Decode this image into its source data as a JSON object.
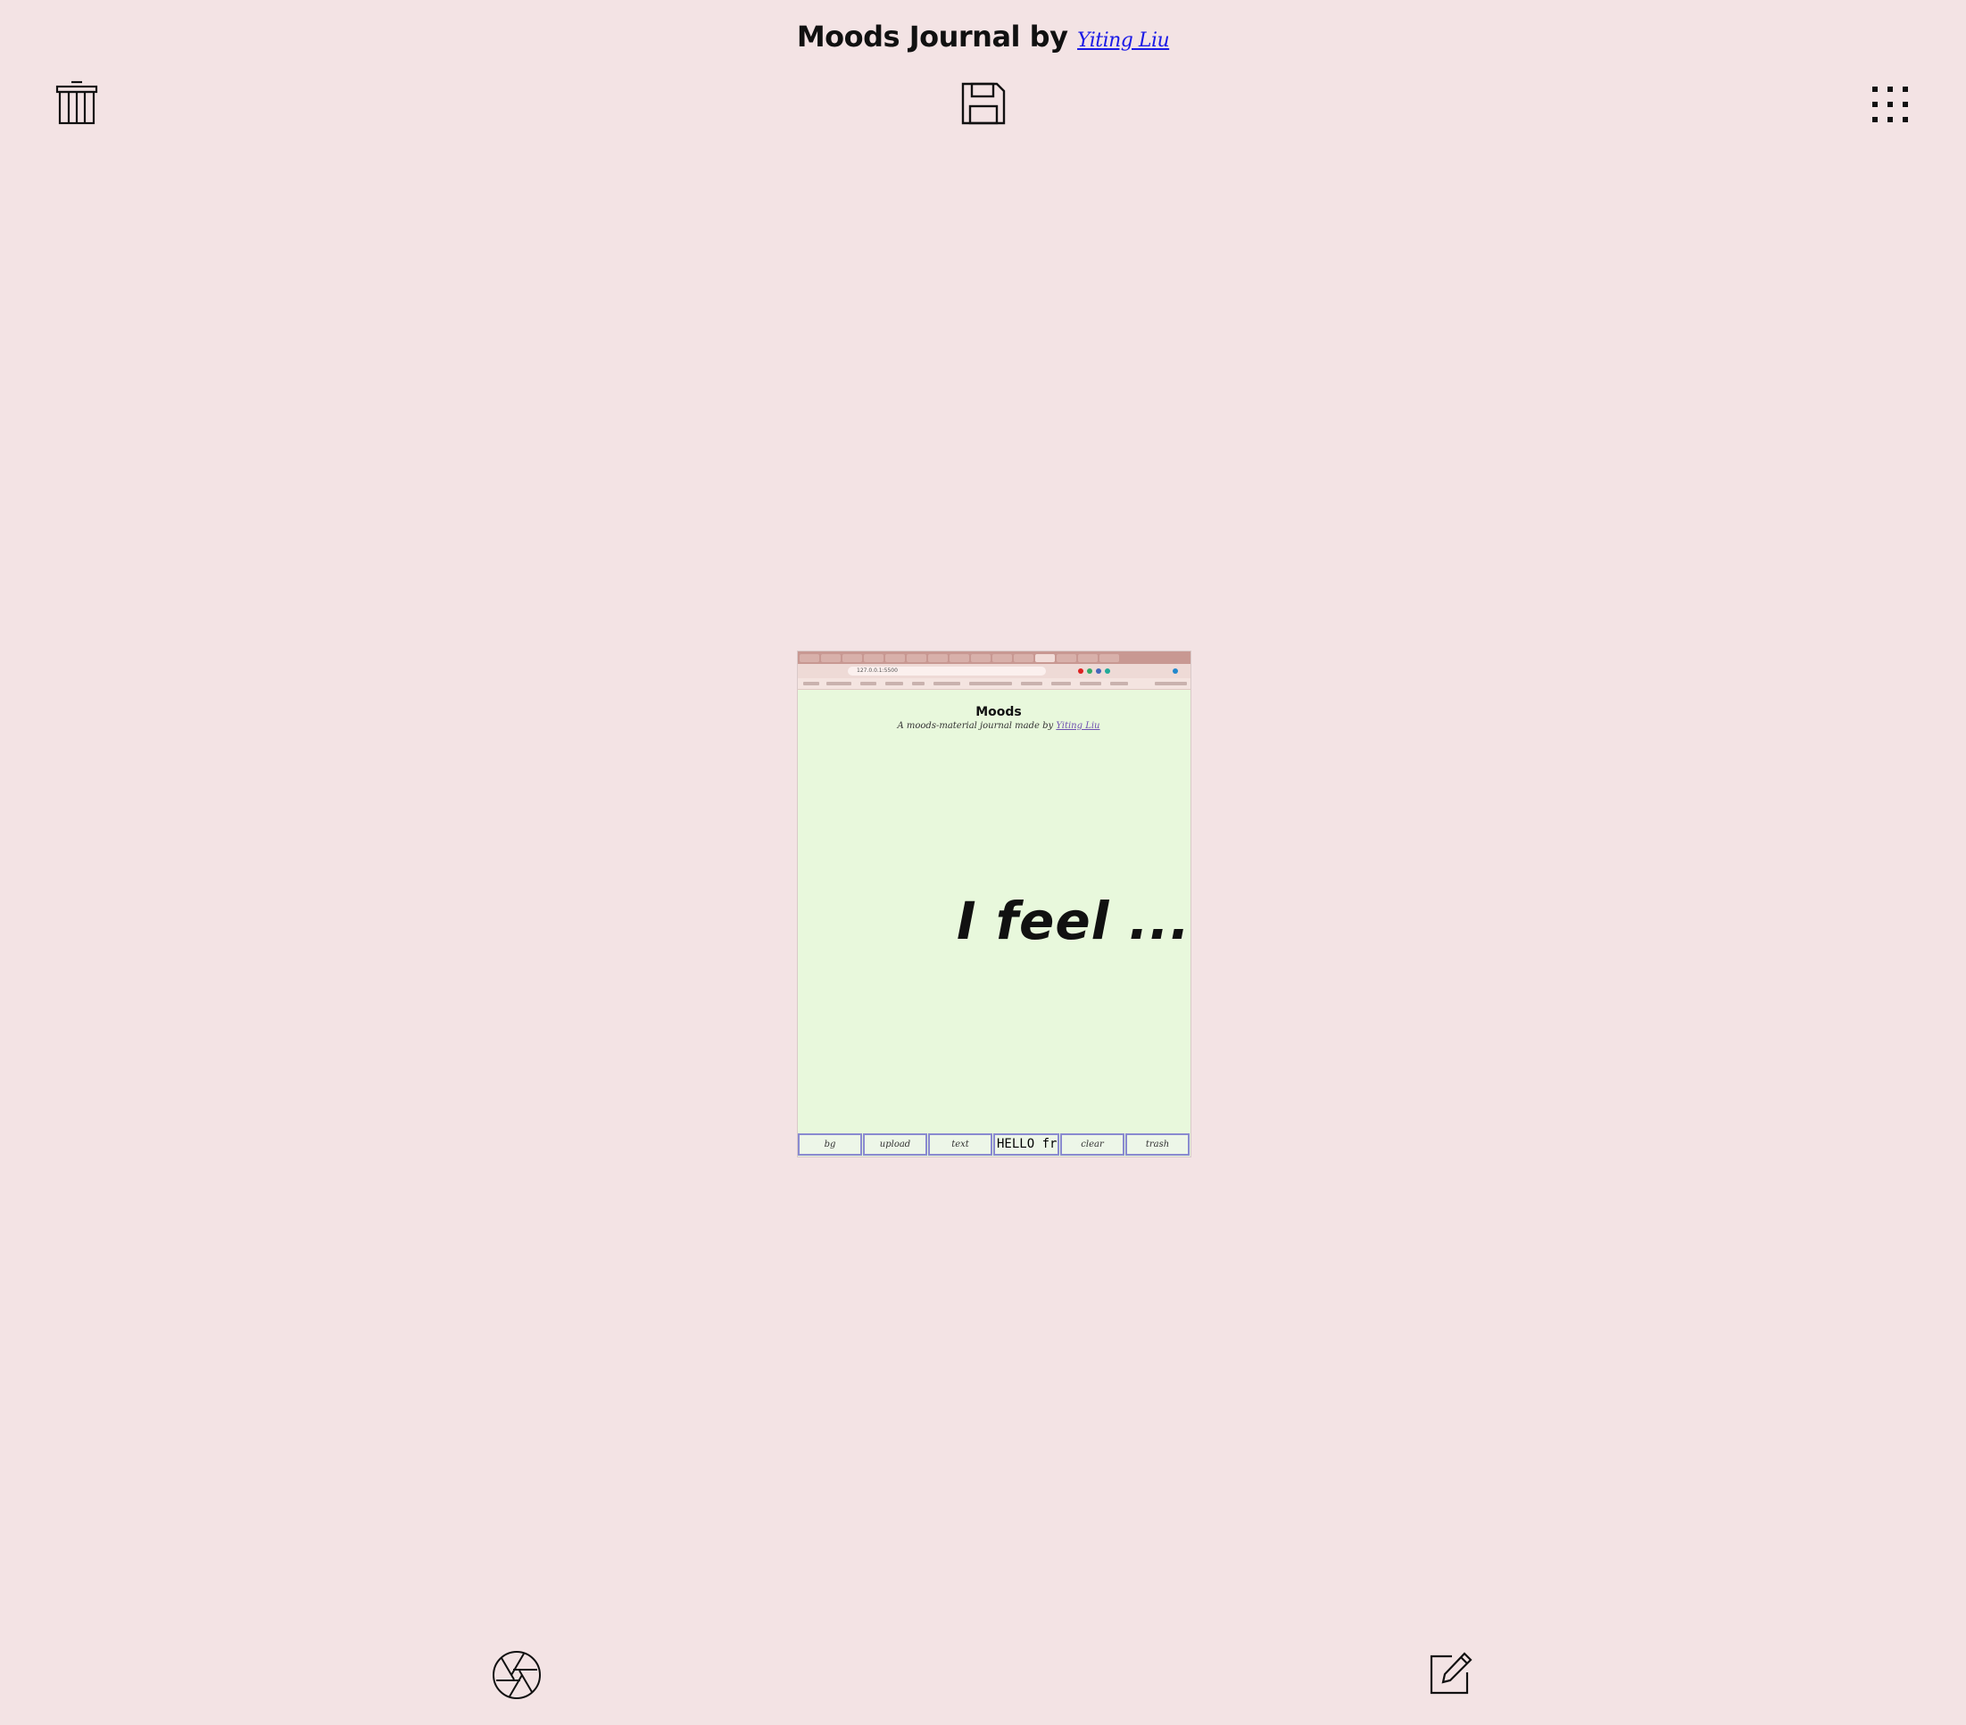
{
  "header": {
    "title": "Moods Journal by",
    "author_link": "Yiting Liu"
  },
  "icons": {
    "trash": "trash-icon",
    "save": "save-icon",
    "grid": "grid-icon",
    "camera": "aperture-icon",
    "edit": "edit-icon"
  },
  "preview": {
    "url": "127.0.0.1:5500",
    "title": "Moods",
    "subtitle": "A moods-material journal made by",
    "subtitle_author": "Yiting Liu",
    "canvas_text": "I feel ...",
    "toolbar": [
      "bg",
      "upload",
      "text",
      "HELLO from",
      "clear",
      "trash"
    ]
  },
  "colors": {
    "background": "#f3e3e4",
    "preview_background": "#e8f8dc",
    "link": "#1a1ae6"
  }
}
